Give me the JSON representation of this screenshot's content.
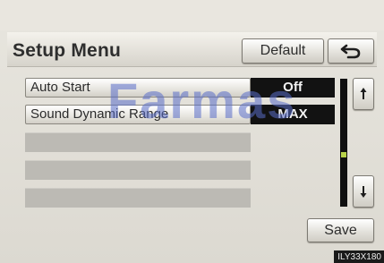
{
  "header": {
    "title": "Setup Menu",
    "default_label": "Default",
    "back_icon": "back-arrow-icon"
  },
  "settings": [
    {
      "label": "Auto Start",
      "value": "Off"
    },
    {
      "label": "Sound Dynamic Range",
      "value": "MAX"
    }
  ],
  "scroll": {
    "up_icon": "scroll-up-arrow-icon",
    "down_icon": "scroll-down-arrow-icon"
  },
  "footer": {
    "save_label": "Save",
    "image_code": "ILY33X180"
  },
  "watermark": "Farmas",
  "colors": {
    "value_bg": "#121212",
    "scroll_indicator": "#b9d34a",
    "watermark": "#5a6ec8"
  }
}
